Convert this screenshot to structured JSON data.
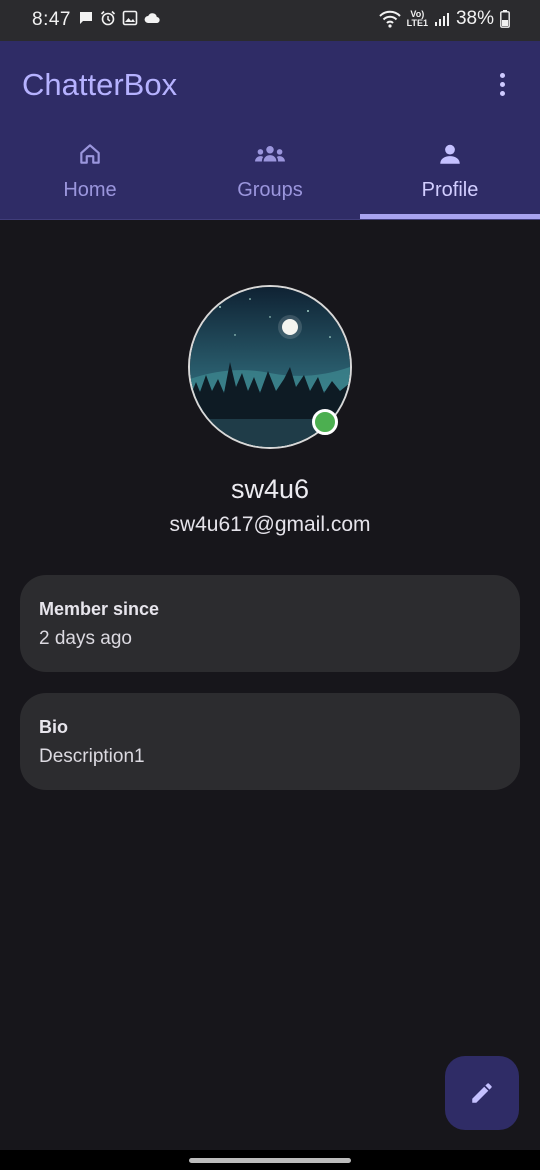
{
  "status_bar": {
    "time": "8:47",
    "left_icons": [
      "message-icon",
      "alarm-icon",
      "image-icon",
      "cloud-icon"
    ],
    "network": {
      "line1": "Vo)",
      "line2": "LTE1"
    },
    "battery_percent": "38%"
  },
  "app": {
    "title": "ChatterBox",
    "menu_icon": "more-vert-icon",
    "accent_color": "#2f2c66",
    "tabs": [
      {
        "label": "Home",
        "icon": "home-icon",
        "active": false
      },
      {
        "label": "Groups",
        "icon": "groups-icon",
        "active": false
      },
      {
        "label": "Profile",
        "icon": "person-icon",
        "active": true
      }
    ]
  },
  "profile": {
    "username": "sw4u6",
    "email": "sw4u617@gmail.com",
    "status": "online",
    "status_color": "#4caf50",
    "cards": [
      {
        "title": "Member since",
        "value": "2 days ago"
      },
      {
        "title": "Bio",
        "value": "Description1"
      }
    ]
  },
  "fab": {
    "icon": "edit-icon"
  }
}
